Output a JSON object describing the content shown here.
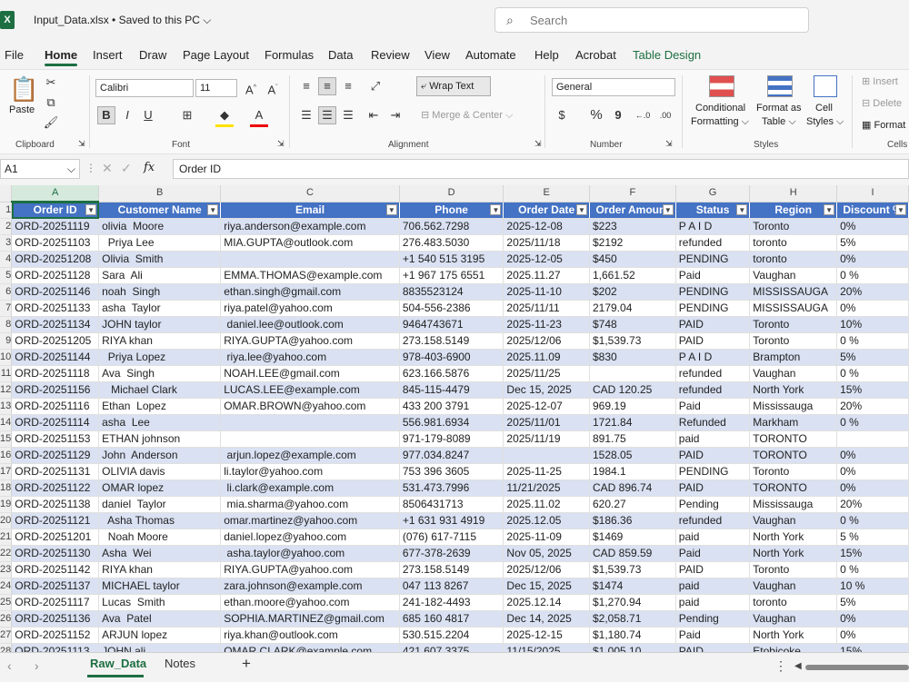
{
  "titlebar": {
    "app_icon": "X",
    "file_title": "Input_Data.xlsx • Saved to this PC ⌵",
    "search_placeholder": "Search"
  },
  "menu": [
    "File",
    "Home",
    "Insert",
    "Draw",
    "Page Layout",
    "Formulas",
    "Data",
    "Review",
    "View",
    "Automate",
    "Help",
    "Acrobat",
    "Table Design"
  ],
  "ribbon": {
    "clipboard": {
      "paste": "Paste",
      "label": "Clipboard"
    },
    "font": {
      "name": "Calibri",
      "size": "11",
      "label": "Font"
    },
    "alignment": {
      "wrap": "Wrap Text",
      "merge": "Merge & Center",
      "label": "Alignment"
    },
    "number": {
      "format": "General",
      "label": "Number"
    },
    "styles": {
      "cond1": "Conditional",
      "cond2": "Formatting ⌵",
      "fmt1": "Format as",
      "fmt2": "Table ⌵",
      "cell1": "Cell",
      "cell2": "Styles ⌵",
      "label": "Styles"
    },
    "cells": {
      "insert": "Insert",
      "delete": "Delete",
      "format": "Format",
      "label": "Cells"
    }
  },
  "formula_bar": {
    "name_box": "A1",
    "fx": "fx",
    "content": "Order ID"
  },
  "columns": [
    "A",
    "B",
    "C",
    "D",
    "E",
    "F",
    "G",
    "H",
    "I"
  ],
  "headers": [
    "Order ID",
    "Customer Name",
    "Email",
    "Phone",
    "Order Date",
    "Order Amount",
    "Status",
    "Region",
    "Discount %"
  ],
  "row_numbers": [
    "1",
    "2",
    "3",
    "4",
    "5",
    "6",
    "7",
    "8",
    "9",
    "10",
    "11",
    "12",
    "13",
    "14",
    "15",
    "16",
    "17",
    "18",
    "19",
    "20",
    "21",
    "22",
    "23",
    "24",
    "25",
    "26",
    "27",
    "28",
    "29"
  ],
  "rows": [
    [
      "ORD-20251119",
      "olivia  Moore",
      "riya.anderson@example.com",
      "706.562.7298",
      "2025-12-08",
      "$223",
      "P A I D",
      "Toronto",
      "0%"
    ],
    [
      "ORD-20251103",
      "  Priya Lee",
      "MIA.GUPTA@outlook.com",
      "276.483.5030",
      "2025/11/18",
      "$2192",
      "refunded",
      "toronto",
      "5%"
    ],
    [
      "ORD-20251208",
      "Olivia  Smith",
      "",
      "+1 540 515 3195",
      "2025-12-05",
      "$450",
      "PENDING",
      "toronto",
      "0%"
    ],
    [
      "ORD-20251128",
      "Sara  Ali",
      "EMMA.THOMAS@example.com",
      "+1 967 175 6551",
      "2025.11.27",
      "1,661.52",
      "Paid",
      "Vaughan",
      "0 %"
    ],
    [
      "ORD-20251146",
      "noah  Singh",
      "ethan.singh@gmail.com",
      "8835523124",
      "2025-11-10",
      "$202",
      "PENDING",
      "MISSISSAUGA",
      "20%"
    ],
    [
      "ORD-20251133",
      "asha  Taylor",
      "riya.patel@yahoo.com",
      "504-556-2386",
      "2025/11/11",
      "2179.04",
      "PENDING",
      "MISSISSAUGA",
      "0%"
    ],
    [
      "ORD-20251134",
      "JOHN taylor",
      " daniel.lee@outlook.com",
      "9464743671",
      "2025-11-23",
      "$748",
      "PAID",
      "Toronto",
      "10%"
    ],
    [
      "ORD-20251205",
      "RIYA khan",
      "RIYA.GUPTA@yahoo.com",
      "273.158.5149",
      "2025/12/06",
      "$1,539.73",
      "PAID",
      "Toronto",
      "0 %"
    ],
    [
      "ORD-20251144",
      "  Priya Lopez",
      " riya.lee@yahoo.com",
      "978-403-6900",
      "2025.11.09",
      "$830",
      "P A I D",
      "Brampton",
      "5%"
    ],
    [
      "ORD-20251118",
      "Ava  Singh",
      "NOAH.LEE@gmail.com",
      "623.166.5876",
      "2025/11/25",
      "",
      "refunded",
      "Vaughan",
      "0 %"
    ],
    [
      "ORD-20251156",
      "   Michael Clark",
      "LUCAS.LEE@example.com",
      "845-115-4479",
      "Dec 15, 2025",
      "CAD 120.25",
      "refunded",
      "North York",
      "15%"
    ],
    [
      "ORD-20251116",
      "Ethan  Lopez",
      "OMAR.BROWN@yahoo.com",
      "433 200 3791",
      "2025-12-07",
      "969.19",
      "Paid",
      "Mississauga",
      "20%"
    ],
    [
      "ORD-20251114",
      "asha  Lee",
      "",
      "556.981.6934",
      "2025/11/01",
      "1721.84",
      "Refunded",
      "Markham",
      "0 %"
    ],
    [
      "ORD-20251153",
      "ETHAN johnson",
      "",
      "971-179-8089",
      "2025/11/19",
      "891.75",
      "paid",
      "TORONTO",
      ""
    ],
    [
      "ORD-20251129",
      "John  Anderson",
      " arjun.lopez@example.com",
      "977.034.8247",
      "",
      "1528.05",
      "PAID",
      "TORONTO",
      "0%"
    ],
    [
      "ORD-20251131",
      "OLIVIA davis",
      "li.taylor@yahoo.com",
      "753 396 3605",
      "2025-11-25",
      "1984.1",
      "PENDING",
      "Toronto",
      "0%"
    ],
    [
      "ORD-20251122",
      "OMAR lopez",
      " li.clark@example.com",
      "531.473.7996",
      "11/21/2025",
      "CAD 896.74",
      "PAID",
      "TORONTO",
      "0%"
    ],
    [
      "ORD-20251138",
      "daniel  Taylor",
      " mia.sharma@yahoo.com",
      "8506431713",
      "2025.11.02",
      "620.27",
      "Pending",
      "Mississauga",
      "20%"
    ],
    [
      "ORD-20251121",
      "  Asha Thomas",
      "omar.martinez@yahoo.com",
      "+1 631 931 4919",
      "2025.12.05",
      "$186.36",
      "refunded",
      "Vaughan",
      "0 %"
    ],
    [
      "ORD-20251201",
      "  Noah Moore",
      "daniel.lopez@yahoo.com",
      "(076) 617-7115",
      "2025-11-09",
      "$1469",
      "paid",
      "North York",
      "5 %"
    ],
    [
      "ORD-20251130",
      "Asha  Wei",
      " asha.taylor@yahoo.com",
      "677-378-2639",
      "Nov 05, 2025",
      "CAD 859.59",
      "Paid",
      "North York",
      "15%"
    ],
    [
      "ORD-20251142",
      "RIYA khan",
      "RIYA.GUPTA@yahoo.com",
      "273.158.5149",
      "2025/12/06",
      "$1,539.73",
      "PAID",
      "Toronto",
      "0 %"
    ],
    [
      "ORD-20251137",
      "MICHAEL taylor",
      "zara.johnson@example.com",
      "047 113 8267",
      "Dec 15, 2025",
      "$1474",
      "paid",
      "Vaughan",
      "10 %"
    ],
    [
      "ORD-20251117",
      "Lucas  Smith",
      "ethan.moore@yahoo.com",
      "241-182-4493",
      "2025.12.14",
      "$1,270.94",
      "paid",
      "toronto",
      "5%"
    ],
    [
      "ORD-20251136",
      "Ava  Patel",
      "SOPHIA.MARTINEZ@gmail.com",
      "685 160 4817",
      "Dec 14, 2025",
      "$2,058.71",
      "Pending",
      "Vaughan",
      "0%"
    ],
    [
      "ORD-20251152",
      "ARJUN lopez",
      "riya.khan@outlook.com",
      "530.515.2204",
      "2025-12-15",
      "$1,180.74",
      "Paid",
      "North York",
      "0%"
    ],
    [
      "ORD-20251113",
      "JOHN ali",
      "OMAR.CLARK@example.com",
      "421.607.3375",
      "11/15/2025",
      "$1,005.10",
      "PAID",
      "Etobicoke",
      "15%"
    ]
  ],
  "sheet_tabs": {
    "active": "Raw_Data",
    "other": "Notes",
    "add": "+"
  }
}
